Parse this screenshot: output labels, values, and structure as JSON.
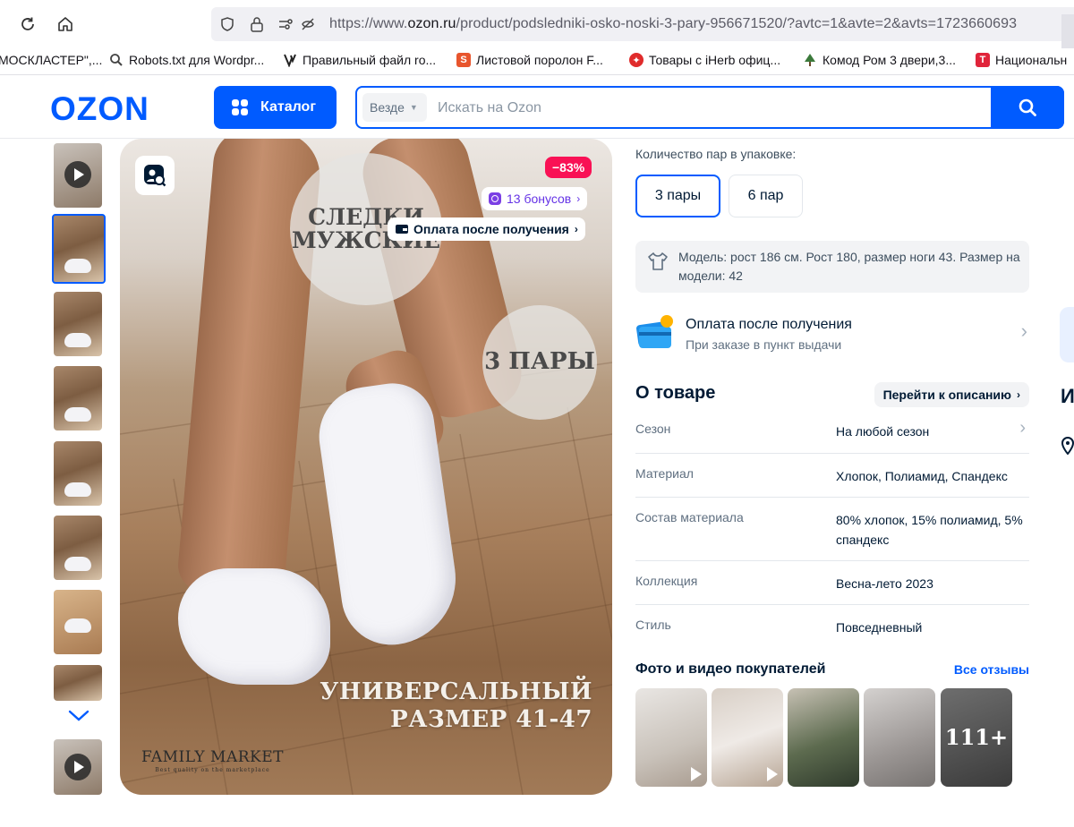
{
  "browser": {
    "url_prefix": "https://www.",
    "url_domain": "ozon.ru",
    "url_path": "/product/podsledniki-osko-noski-3-pary-956671520/?avtc=1&avte=2&avts=1723660693"
  },
  "bookmarks": [
    {
      "label": "МОСКЛАСТЕР\",...",
      "icon": "bookmark-icon"
    },
    {
      "label": "Robots.txt для Wordpr...",
      "icon": "search-icon"
    },
    {
      "label": "Правильный файл ro...",
      "icon": "v-logo-icon"
    },
    {
      "label": "Листовой поролон F...",
      "icon": "s-logo-icon",
      "color": "#e8552d"
    },
    {
      "label": "Товары с iHerb офиц...",
      "icon": "iherb-icon",
      "color": "#e02b2b"
    },
    {
      "label": "Комод Ром 3 двери,3...",
      "icon": "tree-icon",
      "color": "#3b7a3b"
    },
    {
      "label": "Национальн",
      "icon": "t-logo-icon",
      "color": "#e0243a"
    }
  ],
  "header": {
    "logo": "OZON",
    "catalog_label": "Каталог",
    "search_scope": "Везде",
    "search_placeholder": "Искать на Ozon"
  },
  "gallery": {
    "discount": "−83%",
    "bonus": "13 бонусов",
    "pay_after": "Оплата после получения",
    "badge_top": "СЛЕДКИ МУЖСКИЕ",
    "badge_pairs": "3 ПАРЫ",
    "caption_line1": "УНИВЕРСАЛЬНЫЙ",
    "caption_line2": "РАЗМЕР 41-47",
    "brand": "FAMILY MARKET",
    "brand_sub": "Best quality on the marketplace"
  },
  "product": {
    "pairs_label": "Количество пар в упаковке:",
    "pairs_options": [
      "3 пары",
      "6 пар"
    ],
    "pairs_selected": "3 пары",
    "model_info": "Модель: рост 186 см. Рост 180, размер ноги 43. Размер на модели: 42",
    "pay_title": "Оплата после получения",
    "pay_sub": "При заказе в пункт выдачи",
    "about_title": "О товаре",
    "about_link": "Перейти к описанию",
    "specs": [
      {
        "key": "Сезон",
        "value": "На любой сезон"
      },
      {
        "key": "Материал",
        "value": "Хлопок, Полиамид, Спандекс"
      },
      {
        "key": "Состав материала",
        "value": "80% хлопок, 15% полиамид, 5% спандекс"
      },
      {
        "key": "Коллекция",
        "value": "Весна-лето 2023"
      },
      {
        "key": "Стиль",
        "value": "Повседневный"
      }
    ],
    "photos_title": "Фото и видео покупателей",
    "photos_link": "Все отзывы",
    "photos_more": "111+"
  },
  "edge": {
    "letter": "И"
  }
}
